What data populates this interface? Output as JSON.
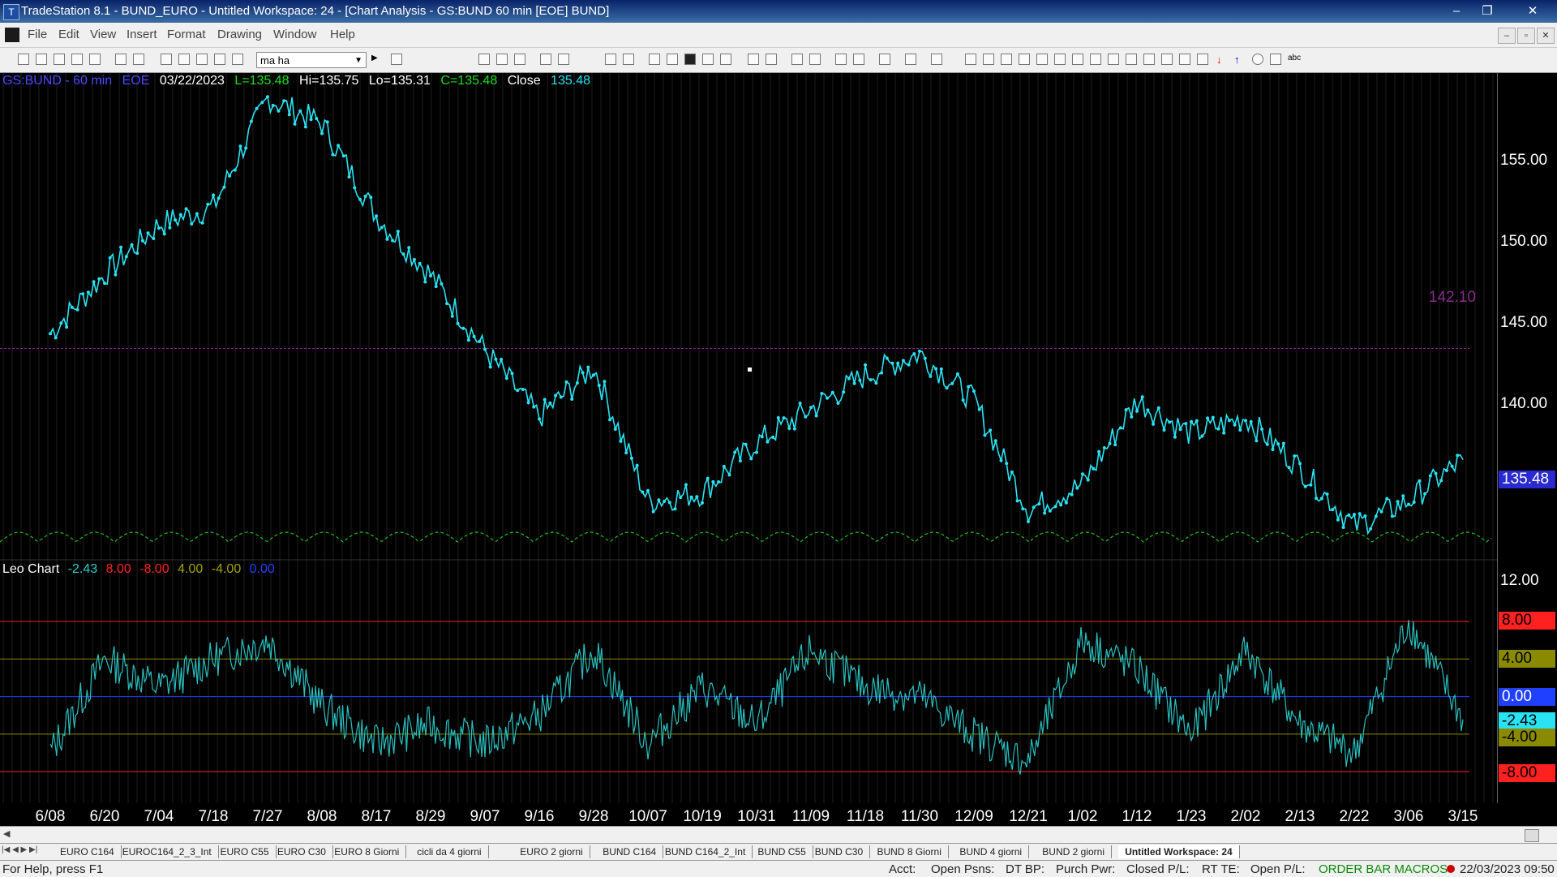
{
  "window": {
    "title": "TradeStation 8.1 - BUND_EURO - Untitled Workspace:  24 - [Chart Analysis - GS:BUND  60 min  [EOE] BUND]",
    "minimize": "‒",
    "restore": "❐",
    "close": "✕"
  },
  "menu": {
    "items": [
      "File",
      "Edit",
      "View",
      "Insert",
      "Format",
      "Drawing",
      "Window",
      "Help"
    ],
    "mdi": [
      "–",
      "▫",
      "✕"
    ]
  },
  "toolbar": {
    "symbol_value": "ma ha"
  },
  "chart_header": {
    "symbol": "GS:BUND - 60 min",
    "session": "EOE",
    "date": "03/22/2023",
    "last": "L=135.48",
    "high": "Hi=135.75",
    "low": "Lo=135.31",
    "close": "C=135.48",
    "close_label": "Close",
    "close_value": "135.48"
  },
  "indicator_header": {
    "name": "Leo Chart",
    "values": [
      "-2.43",
      "8.00",
      "-8.00",
      "4.00",
      "-4.00",
      "0.00"
    ],
    "colors": [
      "#29d0d0",
      "#ff2020",
      "#ff2020",
      "#a0a000",
      "#a0a000",
      "#2040ff"
    ]
  },
  "colors": {
    "price": "#29e3f2",
    "indicator": "#29c0c0",
    "cycle": "#19c019",
    "reference": "#8a2a8a",
    "level_red": "#ff2020",
    "level_olive": "#8a8a00",
    "level_blue": "#2040ff"
  },
  "price_axis": {
    "ticks": [
      "155.00",
      "150.00",
      "145.00",
      "140.00"
    ],
    "reference_label": "142.10",
    "current_label": "135.48"
  },
  "indicator_axis": {
    "ticks": [
      "12.00"
    ],
    "boxes": [
      "8.00",
      "4.00",
      "0.00",
      "-2.43",
      "-4.00",
      "-8.00"
    ]
  },
  "x_axis": {
    "labels": [
      "6/08",
      "6/20",
      "7/04",
      "7/18",
      "7/27",
      "8/08",
      "8/17",
      "8/29",
      "9/07",
      "9/16",
      "9/28",
      "10/07",
      "10/19",
      "10/31",
      "11/09",
      "11/18",
      "11/30",
      "12/09",
      "12/21",
      "1/02",
      "1/12",
      "1/23",
      "2/02",
      "2/13",
      "2/22",
      "3/06",
      "3/15"
    ]
  },
  "chart_data": {
    "type": "line",
    "title": "GS:BUND - 60 min",
    "x": [
      "6/08",
      "6/20",
      "7/04",
      "7/18",
      "7/27",
      "8/08",
      "8/17",
      "8/29",
      "9/07",
      "9/16",
      "9/28",
      "10/07",
      "10/19",
      "10/31",
      "11/09",
      "11/18",
      "11/30",
      "12/09",
      "12/21",
      "1/02",
      "1/12",
      "1/23",
      "2/02",
      "2/13",
      "2/22",
      "3/06",
      "3/15"
    ],
    "series": [
      {
        "name": "Close",
        "values": [
          143.0,
          146.5,
          149.5,
          150.5,
          157.0,
          155.5,
          150.0,
          146.5,
          142.0,
          138.0,
          141.0,
          133.0,
          133.5,
          136.5,
          138.5,
          140.5,
          141.8,
          139.0,
          132.5,
          134.0,
          139.0,
          137.0,
          138.0,
          135.0,
          131.5,
          133.0,
          135.48
        ]
      },
      {
        "name": "Leo Chart",
        "values": [
          -6.0,
          4.0,
          1.0,
          4.0,
          6.0,
          -1.0,
          -5.0,
          -3.0,
          -5.0,
          -2.0,
          5.0,
          -5.0,
          1.0,
          -3.0,
          5.0,
          1.0,
          0.0,
          -4.0,
          -7.0,
          6.0,
          3.0,
          -4.0,
          5.0,
          -3.0,
          -6.0,
          8.0,
          -2.43
        ]
      }
    ],
    "price_ylim": [
      130.0,
      158.5
    ],
    "indicator_ylim": [
      -10.5,
      12.5
    ],
    "levels": [
      8.0,
      4.0,
      0.0,
      -4.0,
      -8.0
    ],
    "reference_line": 142.1,
    "grid": true
  },
  "tabs": [
    "EURO C164",
    "EUROC164_2_3_Int",
    "EURO C55",
    "EURO C30",
    "EURO 8 Giorni",
    "cicli da 4 giorni",
    "EURO 2 giorni",
    "BUND C164",
    "BUND C164_2_Int",
    "BUND C55",
    "BUND  C30",
    "BUND 8 Giorni",
    "BUND 4 giorni",
    "BUND 2 giorni",
    "Untitled Workspace:  24"
  ],
  "status": {
    "help": "For Help, press F1",
    "acct": "Acct:",
    "open_psns": "Open Psns:",
    "dt_bp": "DT BP:",
    "purch_pwr": "Purch Pwr:",
    "closed_pl": "Closed P/L:",
    "rt_te": "RT TE:",
    "open_pl": "Open P/L:",
    "macros": "ORDER BAR  MACROS",
    "datetime": "22/03/2023 09:50"
  }
}
